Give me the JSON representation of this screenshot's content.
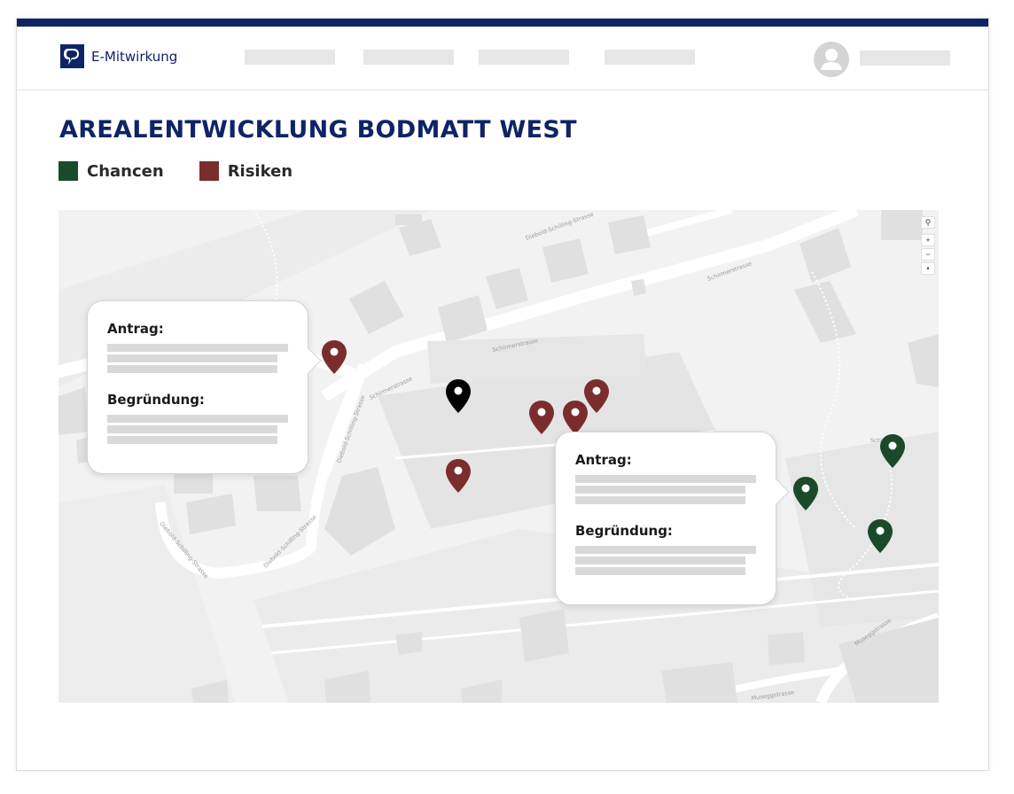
{
  "app": {
    "name": "E-Mitwirkung"
  },
  "page": {
    "title": "AREALENTWICKLUNG BODMATT WEST"
  },
  "legend": [
    {
      "label": "Chancen",
      "color": "#1b4a2b"
    },
    {
      "label": "Risiken",
      "color": "#7b2d2d"
    }
  ],
  "map": {
    "controls": [
      "search-icon",
      "zoom-in",
      "zoom-out",
      "reset"
    ],
    "streets": [
      "Diebold-Schilling-Strasse",
      "Schirmerstrasse",
      "Schirmerstrasse",
      "Schirmerstrasse",
      "Diebold-Schilling-Strasse",
      "Diebold-Schilling-Strasse",
      "Diebold-Schilling-Strasse",
      "Museggstrasse",
      "Museggstrasse",
      "Schi"
    ],
    "popups": [
      {
        "antrag_label": "Antrag:",
        "begruendung_label": "Begründung:"
      },
      {
        "antrag_label": "Antrag:",
        "begruendung_label": "Begründung:"
      }
    ]
  },
  "colors": {
    "brand": "#0e2466",
    "chance": "#1b4a2b",
    "risk": "#7b2d2d",
    "selected": "#000000"
  }
}
